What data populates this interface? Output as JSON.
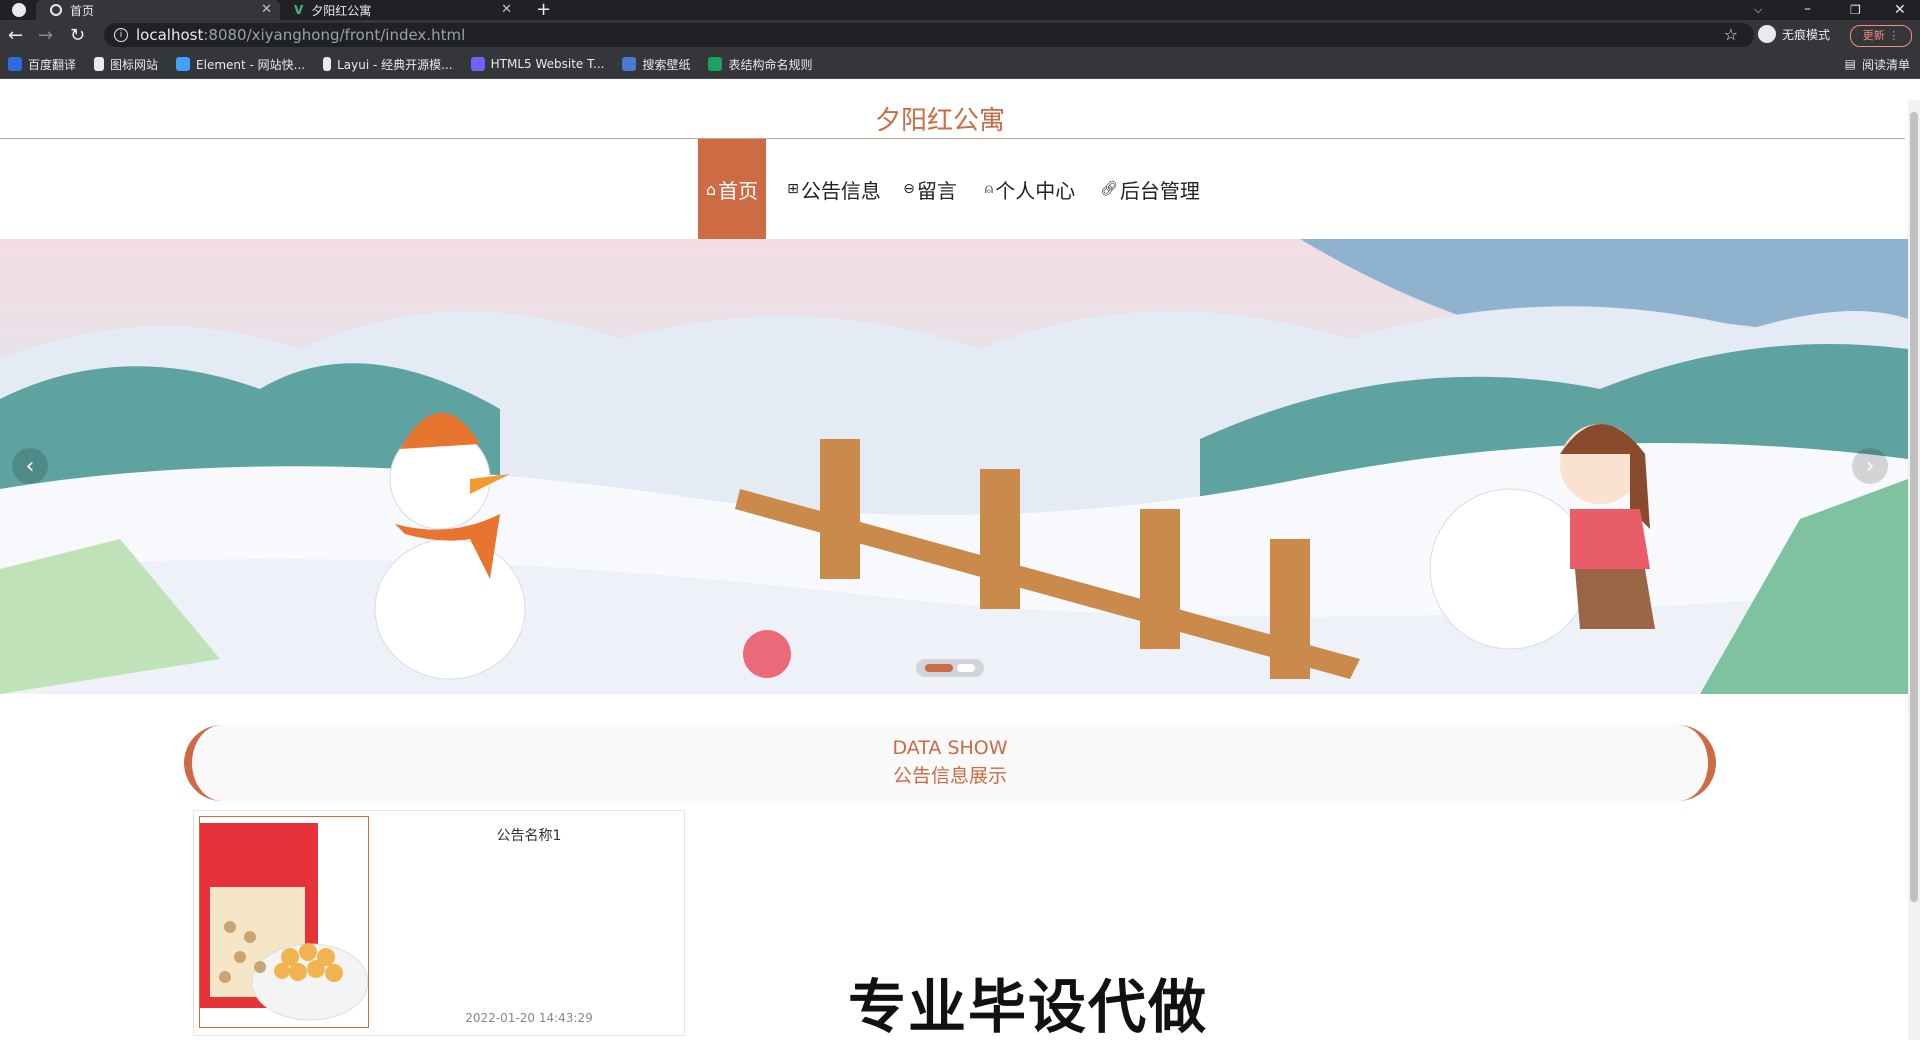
{
  "browser": {
    "tabs": [
      {
        "title": "首页",
        "active": true
      },
      {
        "title": "夕阳红公寓",
        "active": false
      }
    ],
    "url_host": "localhost",
    "url_rest": ":8080/xiyanghong/front/index.html",
    "profile_label": "无痕模式",
    "update_label": "更新",
    "reading_list_label": "阅读清单",
    "bookmarks": [
      {
        "label": "百度翻译",
        "color": "#2d6cdf"
      },
      {
        "label": "图标网站",
        "color": "#ffffff"
      },
      {
        "label": "Element - 网站快...",
        "color": "#409eff"
      },
      {
        "label": "Layui - 经典开源模...",
        "color": "#e8eaed"
      },
      {
        "label": "HTML5 Website T...",
        "color": "#6c63ff"
      },
      {
        "label": "搜索壁纸",
        "color": "#4a78d8"
      },
      {
        "label": "表结构命名规则",
        "color": "#1aa260"
      }
    ]
  },
  "site": {
    "title": "夕阳红公寓",
    "accent_color": "#cd6b45",
    "nav": [
      {
        "label": "首页",
        "icon": "home-icon",
        "active": true
      },
      {
        "label": "公告信息",
        "icon": "grid-icon",
        "active": false
      },
      {
        "label": "留言",
        "icon": "message-icon",
        "active": false
      },
      {
        "label": "个人中心",
        "icon": "user-icon",
        "active": false
      },
      {
        "label": "后台管理",
        "icon": "link-icon",
        "active": false
      }
    ]
  },
  "carousel": {
    "slide_count": 2,
    "active_index": 0
  },
  "section": {
    "en_title": "DATA SHOW",
    "cn_title": "公告信息展示"
  },
  "cards": [
    {
      "title": "公告名称1",
      "time": "2022-01-20 14:43:29"
    }
  ],
  "watermark": "专业毕设代做"
}
